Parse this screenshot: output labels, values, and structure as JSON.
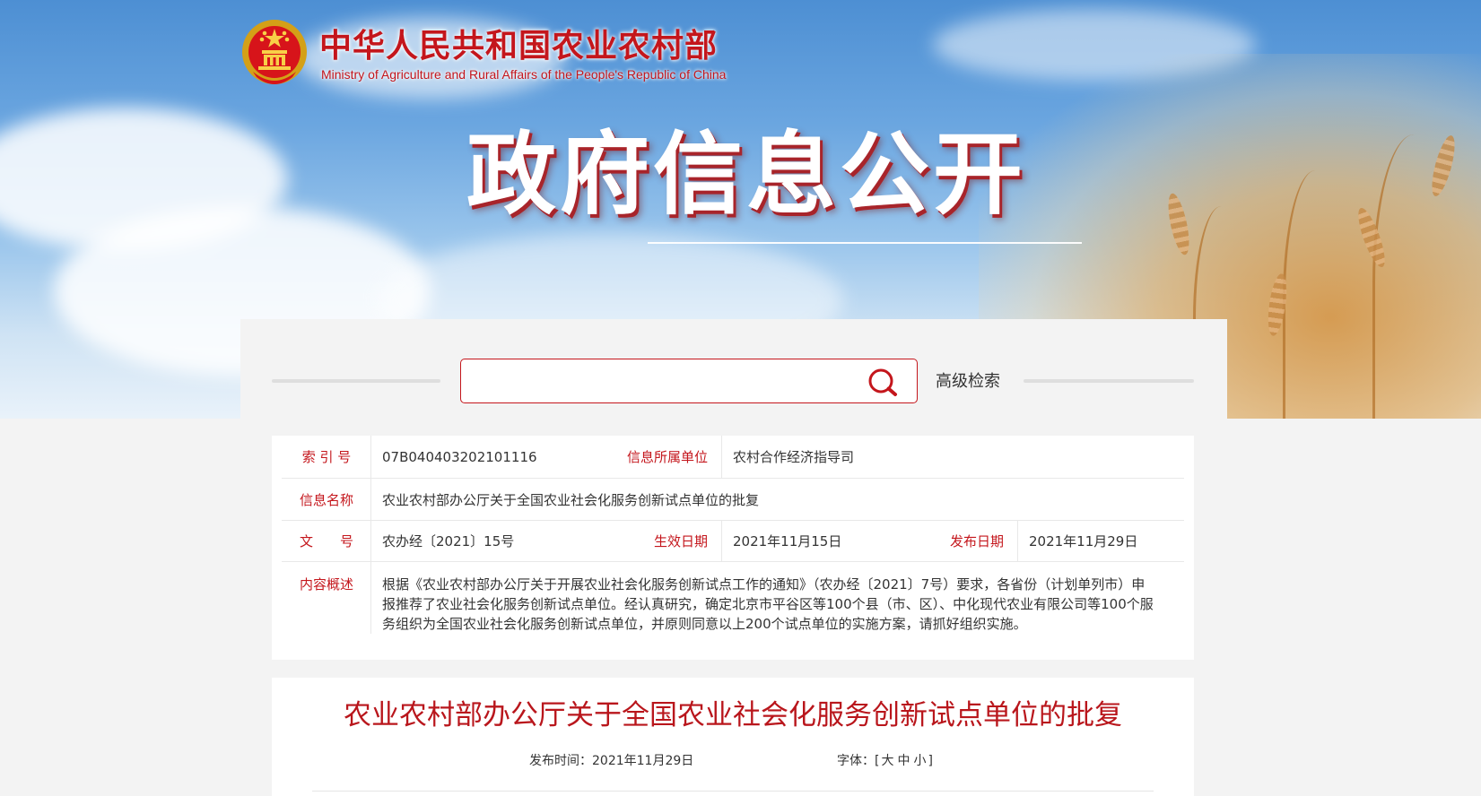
{
  "header": {
    "site_name_cn": "中华人民共和国农业农村部",
    "site_name_en": "Ministry of Agriculture and Rural Affairs of the People's Republic of China",
    "section_title": "政府信息公开",
    "brand_color": "#c4161c"
  },
  "search": {
    "placeholder": "",
    "value": "",
    "icon": "search-icon",
    "advanced_label": "高级检索"
  },
  "meta": {
    "index_label": "索 引 号",
    "index_value": "07B040403202101116",
    "unit_label": "信息所属单位",
    "unit_value": "农村合作经济指导司",
    "name_label": "信息名称",
    "name_value": "农业农村部办公厅关于全国农业社会化服务创新试点单位的批复",
    "doc_label": "文　　号",
    "doc_value": "农办经〔2021〕15号",
    "effective_label": "生效日期",
    "effective_value": "2021年11月15日",
    "publish_label": "发布日期",
    "publish_value": "2021年11月29日",
    "summary_label": "内容概述",
    "summary_value": "根据《农业农村部办公厅关于开展农业社会化服务创新试点工作的通知》（农办经〔2021〕7号）要求，各省份（计划单列市）申报推荐了农业社会化服务创新试点单位。经认真研究，确定北京市平谷区等100个县（市、区）、中化现代农业有限公司等100个服务组织为全国农业社会化服务创新试点单位，并原则同意以上200个试点单位的实施方案，请抓好组织实施。"
  },
  "article": {
    "title": "农业农村部办公厅关于全国农业社会化服务创新试点单位的批复",
    "pub_time_label": "发布时间：",
    "pub_time_value": "2021年11月29日",
    "font_label": "字体：",
    "font_open": "[",
    "font_large": "大",
    "font_medium": "中",
    "font_small": "小",
    "font_close": "]"
  }
}
